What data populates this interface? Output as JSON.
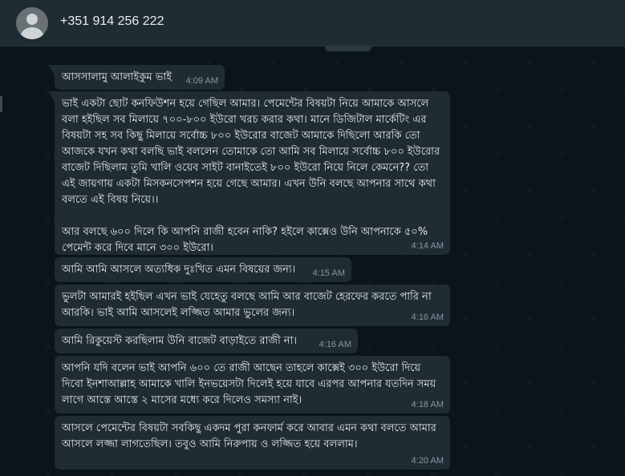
{
  "header": {
    "contact_name": "+351 914 256 222"
  },
  "messages": [
    {
      "text": "আসসালামু আলাইকুম ভাই",
      "time": "4:09 AM"
    },
    {
      "text": "ভাই একটা ছোট কনফিউশন হয়ে গেছিল আমার। পেমেন্টের বিষয়টা নিয়ে আমাকে আসলে বলা হইছিল সব মিলায়ে ৭০০-৮০০ ইউরো খরচ করার কথা। মানে ডিজিটাল মার্কেটিং এর বিষয়টা সহ সব কিছু মিলায়ে সর্বোচ্চ ৮০০ ইউরোর বাজেট আমাকে দিছিলো আরকি তো আজকে যখন কথা বলছি ভাই বললেন তোমাকে তো আমি সব মিলায়ে সর্বোচ্চ ৮০০ ইউরোর বাজেট দিছিলাম তুমি খালি ওয়েব সাইট বানাইতেই ৮০০ ইউরো নিয়ে নিলে কেমনে?? তো এই জায়গায় একটা মিসকনসেপশন হয়ে গেছে আমার। এখন উনি বলছে আপনার সাথে কথা বলতে এই বিষয় নিয়ে।।\n\nআর বলছে ৬০০ দিলে কি আপনি রাজী হবেন নাকি? হইলে কাক্সেও উনি আপনাকে ৫০% পেমেন্ট করে দিবে মানে ৩০০ ইউরো।",
      "time": "4:14 AM"
    },
    {
      "text": "আমি আমি আসলে অত্যধিক দুঃখিত এমন বিষয়ের জন্য।",
      "time": "4:15 AM"
    },
    {
      "text": "ভুলটা আমারই হইছিল এখন ভাই যেহেতু বলছে আমি আর বাজেট হেরফের করতে পারি না আরকি। ভাই আমি আসলেই লজ্জিত আমার ভুলের জন্য।",
      "time": "4:16 AM"
    },
    {
      "text": "আমি রিকুয়েস্ট করছিলাম উনি বাজেট বাড়াইতে রাজী না।",
      "time": "4:16 AM"
    },
    {
      "text": "আপনি যদি বলেন ভাই আপনি ৬০০ তে রাজী আছেন তাহলে কাক্সেই ৩০০ ইউরো দিয়ে দিবো ইনশাআল্লাহ আমাকে খালি ইনভয়েসটা দিলেই হয়ে যাবে এরপর আপনার যতদিন সময় লাগে আস্তে আস্তে ২ মাসের মধ্যে করে দিলেও সমস্যা নাই।",
      "time": "4:18 AM"
    },
    {
      "text": "আসলে পেমেন্টের বিষয়টা সবকিছু একদম পুরা কনফার্ম করে আবার এমন কথা বলতে আমার আসলে লজ্জা লাগতেছিল। তবুও আমি নিরুপায় ও লজ্জিত হয়ে বললাম।",
      "time": "4:20 AM"
    }
  ]
}
